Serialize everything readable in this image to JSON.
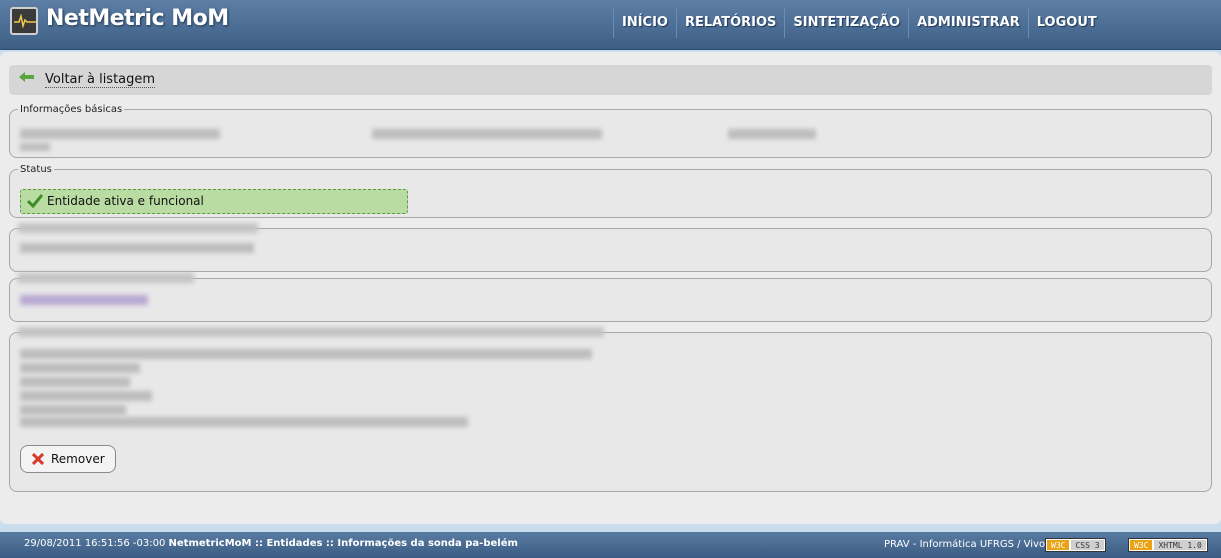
{
  "header": {
    "app_title": "NetMetric MoM",
    "nav": [
      "INÍCIO",
      "RELATÓRIOS",
      "SINTETIZAÇÃO",
      "ADMINISTRAR",
      "LOGOUT"
    ]
  },
  "main": {
    "back_link": "Voltar à listagem",
    "basic_info_legend": "Informações básicas",
    "status_legend": "Status",
    "status_text": "Entidade ativa e funcional",
    "remove_label": "Remover"
  },
  "footer": {
    "timestamp": "29/08/2011 16:51:56 -03:00",
    "breadcrumb": "NetmetricMoM :: Entidades :: Informações da sonda pa-belém",
    "credit": "PRAV - Informática UFRGS / Vivo",
    "badge1_w3c": "W3C",
    "badge1_spec": "CSS 3",
    "badge2_w3c": "W3C",
    "badge2_spec": "XHTML 1.0"
  },
  "colors": {
    "header": "#4a6d95",
    "status_ok": "#b9dca2",
    "panel": "#ececec"
  }
}
